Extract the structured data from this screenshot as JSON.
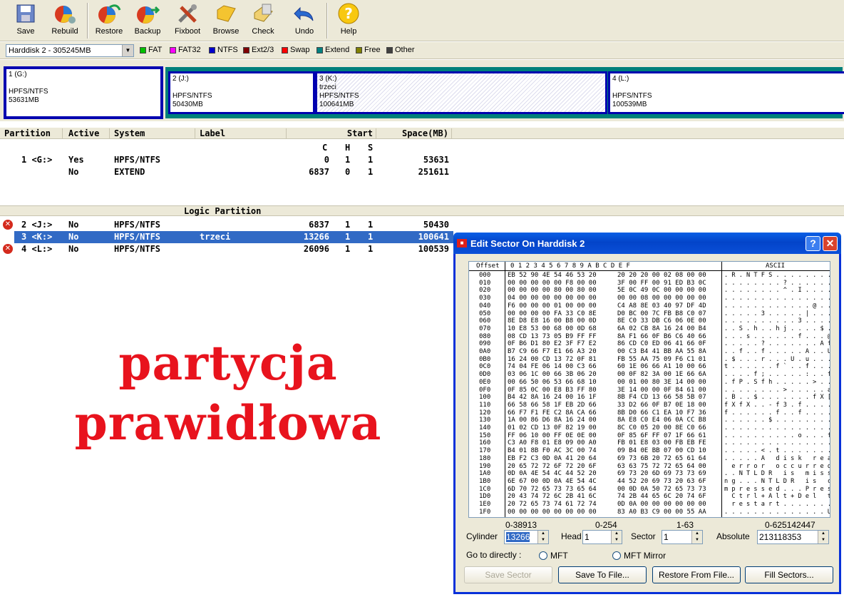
{
  "toolbar": {
    "buttons": [
      {
        "label": "Save",
        "icon": "save-icon"
      },
      {
        "label": "Rebuild",
        "icon": "rebuild-icon"
      },
      {
        "label": "Restore",
        "icon": "restore-icon"
      },
      {
        "label": "Backup",
        "icon": "backup-icon"
      },
      {
        "label": "Fixboot",
        "icon": "fixboot-icon"
      },
      {
        "label": "Browse",
        "icon": "browse-icon"
      },
      {
        "label": "Check",
        "icon": "check-icon"
      },
      {
        "label": "Undo",
        "icon": "undo-icon"
      },
      {
        "label": "Help",
        "icon": "help-icon"
      }
    ]
  },
  "disk_select": {
    "value": "Harddisk 2 - 305245MB"
  },
  "legend": [
    {
      "label": "FAT",
      "color": "#00c000"
    },
    {
      "label": "FAT32",
      "color": "#ff00ff"
    },
    {
      "label": "NTFS",
      "color": "#0000cc"
    },
    {
      "label": "Ext2/3",
      "color": "#800000"
    },
    {
      "label": "Swap",
      "color": "#ff0000"
    },
    {
      "label": "Extend",
      "color": "#008080"
    },
    {
      "label": "Free",
      "color": "#808000"
    },
    {
      "label": "Other",
      "color": "#404040"
    }
  ],
  "diskmap": [
    {
      "name": "1 (G:)",
      "label": "",
      "fs": "HPFS/NTFS",
      "size": "53631MB"
    },
    {
      "name": "2 (J:)",
      "label": "",
      "fs": "HPFS/NTFS",
      "size": "50430MB"
    },
    {
      "name": "3 (K:)",
      "label": "trzeci",
      "fs": "HPFS/NTFS",
      "size": "100641MB"
    },
    {
      "name": "4 (L:)",
      "label": "",
      "fs": "HPFS/NTFS",
      "size": "100539MB"
    }
  ],
  "table": {
    "headers": {
      "partition": "Partition",
      "active": "Active",
      "system": "System",
      "label": "Label",
      "start": "Start",
      "space": "Space(MB)"
    },
    "chs": {
      "c": "C",
      "h": "H",
      "s": "S"
    },
    "primary": [
      {
        "partition": "1 <G:>",
        "active": "Yes",
        "system": "HPFS/NTFS",
        "label": "",
        "c": "0",
        "h": "1",
        "s": "1",
        "space": "53631"
      },
      {
        "partition": "",
        "active": "No",
        "system": "EXTEND",
        "label": "",
        "c": "6837",
        "h": "0",
        "s": "1",
        "space": "251611"
      }
    ],
    "logic_title": "Logic Partition",
    "logic": [
      {
        "partition": "2 <J:>",
        "active": "No",
        "system": "HPFS/NTFS",
        "label": "",
        "c": "6837",
        "h": "1",
        "s": "1",
        "space": "50430"
      },
      {
        "partition": "3 <K:>",
        "active": "No",
        "system": "HPFS/NTFS",
        "label": "trzeci",
        "c": "13266",
        "h": "1",
        "s": "1",
        "space": "100641"
      },
      {
        "partition": "4 <L:>",
        "active": "No",
        "system": "HPFS/NTFS",
        "label": "",
        "c": "26096",
        "h": "1",
        "s": "1",
        "space": "100539"
      }
    ]
  },
  "overlay_text": {
    "line1": "partycja",
    "line2": "prawidłowa"
  },
  "dialog": {
    "title": "Edit Sector On Harddisk 2",
    "hex_header": {
      "offset": "Offset",
      "cols": [
        "0",
        "1",
        "2",
        "3",
        "4",
        "5",
        "6",
        "7",
        "8",
        "9",
        "A",
        "B",
        "C",
        "D",
        "E",
        "F"
      ],
      "ascii": "ASCII"
    },
    "rows": [
      {
        "o": "000",
        "h1": "EB 52 90 4E 54 46 53 20",
        "h2": "20 20 20 00 02 08 00 00",
        "a": ". R . N T F S . . . . . . . . ."
      },
      {
        "o": "010",
        "h1": "00 00 00 00 00 F8 00 00",
        "h2": "3F 00 FF 00 91 ED B3 0C",
        "a": ". . . . . . . . ? . . . . . . ."
      },
      {
        "o": "020",
        "h1": "00 00 00 00 80 00 80 00",
        "h2": "5E 0C 49 0C 00 00 00 00",
        "a": ". . . . . . . . ^ . I . . . . ."
      },
      {
        "o": "030",
        "h1": "04 00 00 00 00 00 00 00",
        "h2": "00 00 08 00 00 00 00 00",
        "a": ". . . . . . . . . . . . . . . ."
      },
      {
        "o": "040",
        "h1": "F6 00 00 00 01 00 00 00",
        "h2": "C4 A8 8E 03 40 97 DF 4D",
        "a": ". . . . . . . . . . . . @ . . M"
      },
      {
        "o": "050",
        "h1": "00 00 00 00 FA 33 C0 8E",
        "h2": "D0 BC 00 7C FB B8 C0 07",
        "a": ". . . . . 3 . . . . . | . . . ."
      },
      {
        "o": "060",
        "h1": "8E D8 E8 16 00 B8 00 0D",
        "h2": "8E C0 33 DB C6 06 0E 00",
        "a": ". . . . . . . . . . 3 . . . . ."
      },
      {
        "o": "070",
        "h1": "10 E8 53 00 68 00 0D 68",
        "h2": "6A 02 CB 8A 16 24 00 B4",
        "a": ". . S . h . . h j . . . . $ . ."
      },
      {
        "o": "080",
        "h1": "08 CD 13 73 05 B9 FF FF",
        "h2": "8A F1 66 0F B6 C6 40 66",
        "a": ". . . s . . . . . . f . . . @ f"
      },
      {
        "o": "090",
        "h1": "0F B6 D1 80 E2 3F F7 E2",
        "h2": "86 CD C0 ED 06 41 66 0F",
        "a": ". . . . . ? . . . . . . . A f ."
      },
      {
        "o": "0A0",
        "h1": "B7 C9 66 F7 E1 66 A3 20",
        "h2": "00 C3 B4 41 BB AA 55 8A",
        "a": ". . f . . f . . . . . A . . U ."
      },
      {
        "o": "0B0",
        "h1": "16 24 00 CD 13 72 0F 81",
        "h2": "FB 55 AA 75 09 F6 C1 01",
        "a": ". $ . . . r . . . U . u . . . ."
      },
      {
        "o": "0C0",
        "h1": "74 04 FE 06 14 00 C3 66",
        "h2": "60 1E 06 66 A1 10 00 66",
        "a": "t . . . . . . f ` . . f . . . f"
      },
      {
        "o": "0D0",
        "h1": "03 06 1C 00 66 3B 06 20",
        "h2": "00 0F 82 3A 00 1E 66 6A",
        "a": ". . . . f ; . . . . . : . . f j"
      },
      {
        "o": "0E0",
        "h1": "00 66 50 06 53 66 68 10",
        "h2": "00 01 00 80 3E 14 00 00",
        "a": ". f P . S f h . . . . . > . . ."
      },
      {
        "o": "0F0",
        "h1": "0F 85 0C 00 E8 B3 FF 80",
        "h2": "3E 14 00 00 0F 84 61 00",
        "a": ". . . . . . . . > . . . . . a ."
      },
      {
        "o": "100",
        "h1": "B4 42 8A 16 24 00 16 1F",
        "h2": "8B F4 CD 13 66 58 5B 07",
        "a": ". B . . $ . . . . . . . f X [ ."
      },
      {
        "o": "110",
        "h1": "66 58 66 58 1F EB 2D 66",
        "h2": "33 D2 66 0F B7 0E 18 00",
        "a": "f X f X . . - f 3 . f . . . . ."
      },
      {
        "o": "120",
        "h1": "66 F7 F1 FE C2 8A CA 66",
        "h2": "8B D0 66 C1 EA 10 F7 36",
        "a": "f . . . . . . f . . f . . . . 6"
      },
      {
        "o": "130",
        "h1": "1A 00 86 D6 8A 16 24 00",
        "h2": "8A E8 C0 E4 06 0A CC B8",
        "a": ". . . . . . $ . . . . . . . . ."
      },
      {
        "o": "140",
        "h1": "01 02 CD 13 0F 82 19 00",
        "h2": "8C C0 05 20 00 8E C0 66",
        "a": ". . . . . . . . . . . . . . . f"
      },
      {
        "o": "150",
        "h1": "FF 06 10 00 FF 0E 0E 00",
        "h2": "0F 85 6F FF 07 1F 66 61",
        "a": ". . . . . . . . . . o . . . f a"
      },
      {
        "o": "160",
        "h1": "C3 A0 F8 01 E8 09 00 A0",
        "h2": "FB 01 E8 03 00 FB EB FE",
        "a": ". . . . . . . . . . . . . . . ."
      },
      {
        "o": "170",
        "h1": "B4 01 8B F0 AC 3C 00 74",
        "h2": "09 B4 0E BB 07 00 CD 10",
        "a": ". . . . . < . t . . . . . . . ."
      },
      {
        "o": "180",
        "h1": "EB F2 C3 0D 0A 41 20 64",
        "h2": "69 73 6B 20 72 65 61 64",
        "a": ". . . . . A   d i s k   r e a d"
      },
      {
        "o": "190",
        "h1": "20 65 72 72 6F 72 20 6F",
        "h2": "63 63 75 72 72 65 64 00",
        "a": "  e r r o r   o c c u r r e d ."
      },
      {
        "o": "1A0",
        "h1": "0D 0A 4E 54 4C 44 52 20",
        "h2": "69 73 20 6D 69 73 73 69",
        "a": ". . N T L D R   i s   m i s s i"
      },
      {
        "o": "1B0",
        "h1": "6E 67 00 0D 0A 4E 54 4C",
        "h2": "44 52 20 69 73 20 63 6F",
        "a": "n g . . . N T L D R   i s   c o"
      },
      {
        "o": "1C0",
        "h1": "6D 70 72 65 73 73 65 64",
        "h2": "00 0D 0A 50 72 65 73 73",
        "a": "m p r e s s e d . . . P r e s s"
      },
      {
        "o": "1D0",
        "h1": "20 43 74 72 6C 2B 41 6C",
        "h2": "74 2B 44 65 6C 20 74 6F",
        "a": "  C t r l + A l t + D e l   t o"
      },
      {
        "o": "1E0",
        "h1": "20 72 65 73 74 61 72 74",
        "h2": "0D 0A 00 00 00 00 00 00",
        "a": "  r e s t a r t . . . . . . . ."
      },
      {
        "o": "1F0",
        "h1": "00 00 00 00 00 00 00 00",
        "h2": "83 A0 B3 C9 00 00 55 AA",
        "a": ". . . . . . . . . . . . . . U ."
      }
    ],
    "ranges": {
      "cylinder": "0-38913",
      "head": "0-254",
      "sector": "1-63",
      "absolute": "0-625142447"
    },
    "fields": {
      "cylinder_label": "Cylinder",
      "cylinder_value": "13266",
      "head_label": "Head",
      "head_value": "1",
      "sector_label": "Sector",
      "sector_value": "1",
      "absolute_label": "Absolute",
      "absolute_value": "213118353"
    },
    "goto_label": "Go to directly :",
    "radio_mft": "MFT",
    "radio_mft_mirror": "MFT Mirror",
    "buttons": {
      "save_sector": "Save Sector",
      "save_to_file": "Save To File...",
      "restore_from_file": "Restore From File...",
      "fill_sectors": "Fill Sectors..."
    }
  }
}
